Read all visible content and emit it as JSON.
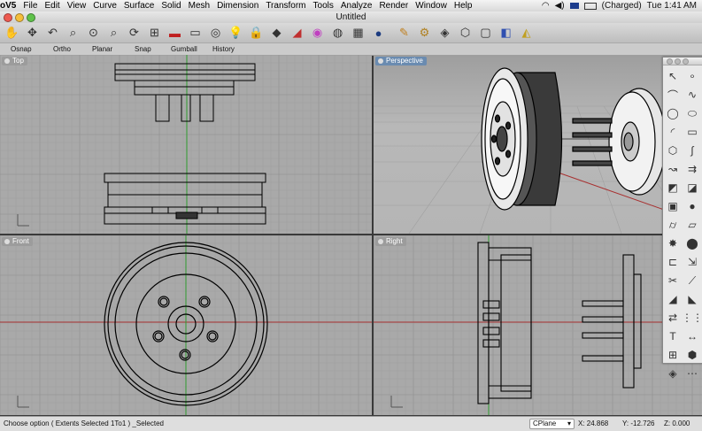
{
  "menubar": {
    "app": "oV5",
    "items": [
      "File",
      "Edit",
      "View",
      "Curve",
      "Surface",
      "Solid",
      "Mesh",
      "Dimension",
      "Transform",
      "Tools",
      "Analyze",
      "Render",
      "Window",
      "Help"
    ],
    "battery": "(Charged)",
    "clock": "Tue 1:41 AM"
  },
  "window": {
    "title": "Untitled"
  },
  "toolbar": {
    "icons": [
      "hand-pan-icon",
      "move-icon",
      "undo-icon",
      "zoom-window-icon",
      "zoom-extents-icon",
      "zoom-selected-icon",
      "rotate-view-icon",
      "four-viewports-icon",
      "car-shaded-icon",
      "car-wire-icon",
      "cplane-icon",
      "bulb-icon",
      "lock-icon",
      "layers-icon",
      "material-icon",
      "color-wheel-icon",
      "render-sphere-icon",
      "mesh-icon",
      "sphere-icon",
      "pencil-icon",
      "gear-icon",
      "boolean-icon",
      "box-icon",
      "cube-icon",
      "analysis-icon"
    ]
  },
  "osnapbar": {
    "items": [
      "Osnap",
      "Ortho",
      "Planar",
      "Snap",
      "Gumball",
      "History"
    ]
  },
  "viewports": {
    "top": {
      "label": "Top"
    },
    "perspective": {
      "label": "Perspective"
    },
    "front": {
      "label": "Front"
    },
    "right": {
      "label": "Right"
    }
  },
  "palette": {
    "icons": [
      "select-arrow-icon",
      "point-icon",
      "polyline-icon",
      "curve-icon",
      "circle-icon",
      "ellipse-icon",
      "arc-icon",
      "rectangle-icon",
      "polygon-icon",
      "freeform-curve-icon",
      "fillet-curve-icon",
      "offset-curve-icon",
      "surface-icon",
      "surface-edit-icon",
      "box-solid-icon",
      "sphere-solid-icon",
      "cylinder-icon",
      "plane-surface-icon",
      "explode-icon",
      "boolean-union-icon",
      "extrude-icon",
      "join-icon",
      "trim-icon",
      "split-icon",
      "fillet-icon",
      "chamfer-icon",
      "transform-icon",
      "array-icon",
      "text-icon",
      "dimension-icon",
      "group-icon",
      "block-icon",
      "render-icon",
      "more-icon"
    ]
  },
  "status": {
    "message": "Choose option ( Extents Selected 1To1 ) _Selected",
    "cplane": "CPlane",
    "x": "X: 24.868",
    "y": "Y: -12.726",
    "z": "Z: 0.000"
  },
  "colors": {
    "viewport_bg": "#a9a9a9",
    "grid_line": "#9a9a9a",
    "x_axis": "#a83030",
    "y_axis": "#2f9a2f",
    "active_tab": "#6a8bb0"
  }
}
